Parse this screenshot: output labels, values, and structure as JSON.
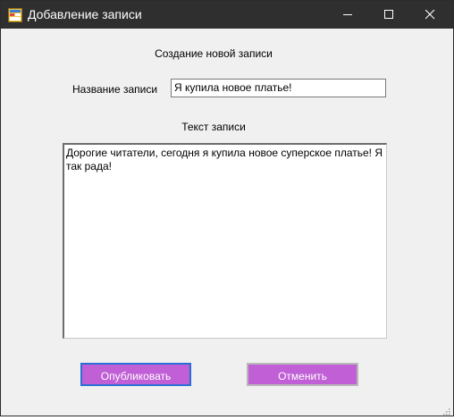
{
  "window": {
    "title": "Добавление записи",
    "title_icon": "app-form-icon",
    "controls": {
      "minimize_icon": "minimize-icon",
      "maximize_icon": "maximize-icon",
      "close_icon": "close-icon"
    }
  },
  "form": {
    "heading": "Создание новой записи",
    "title_label": "Название записи",
    "title_value": "Я купила новое платье!",
    "text_label": "Текст записи",
    "text_value": "Дорогие читатели, сегодня я купила новое суперское платье! Я так рада!"
  },
  "buttons": {
    "publish_label": "Опубликовать",
    "cancel_label": "Отменить"
  },
  "colors": {
    "titlebar": "#2f2f2f",
    "button_fill": "#c05fd6",
    "focus_border": "#2b6fd6",
    "client_bg": "#f0f0f0"
  }
}
